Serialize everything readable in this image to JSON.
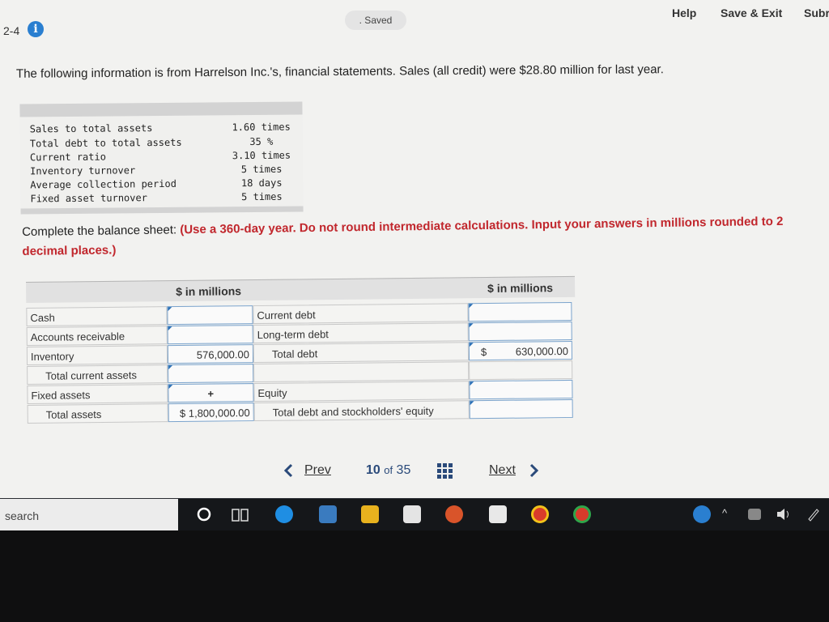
{
  "header": {
    "question_number": "2-4",
    "saved_label": ". Saved",
    "help_label": "Help",
    "save_exit_label": "Save & Exit",
    "submit_label": "Subr"
  },
  "prompt": "The following information is from Harrelson Inc.'s, financial statements. Sales (all credit) were $28.80 million for last year.",
  "ratios": [
    {
      "label": "Sales to total assets",
      "value": "1.60 times"
    },
    {
      "label": "Total debt to total assets",
      "value": "35 %"
    },
    {
      "label": "Current ratio",
      "value": "3.10 times"
    },
    {
      "label": "Inventory turnover",
      "value": "5 times"
    },
    {
      "label": "Average collection period",
      "value": "18 days"
    },
    {
      "label": "Fixed asset turnover",
      "value": "5 times"
    }
  ],
  "instructions": {
    "lead": "Complete the balance sheet:",
    "bold": "(Use a 360-day year. Do not round intermediate calculations. Input your answers in millions rounded to 2 decimal places.)"
  },
  "balance_sheet": {
    "left_header": "$ in millions",
    "right_header": "$ in millions",
    "left_rows": [
      {
        "label": "Cash",
        "value": ""
      },
      {
        "label": "Accounts receivable",
        "value": ""
      },
      {
        "label": "Inventory",
        "value": "576,000.00"
      },
      {
        "label": "Total current assets",
        "value": ""
      },
      {
        "label": "Fixed assets",
        "value": ""
      },
      {
        "label": "Total assets",
        "value": "$ 1,800,000.00"
      }
    ],
    "right_rows": [
      {
        "label": "Current debt",
        "value": ""
      },
      {
        "label": "Long-term debt",
        "value": ""
      },
      {
        "label": "Total debt",
        "currency": "$",
        "value": "630,000.00"
      },
      {
        "label": "",
        "value": ""
      },
      {
        "label": "Equity",
        "value": ""
      },
      {
        "label": "Total debt and stockholders' equity",
        "value": ""
      }
    ]
  },
  "navigation": {
    "prev_label": "Prev",
    "current_page": "10",
    "of_label": "of",
    "total_pages": "35",
    "next_label": "Next"
  },
  "taskbar": {
    "search_placeholder": "search"
  },
  "colors": {
    "emphasis_red": "#c1272d",
    "nav_blue": "#2a4a7a",
    "info_blue": "#2a7fd0"
  }
}
